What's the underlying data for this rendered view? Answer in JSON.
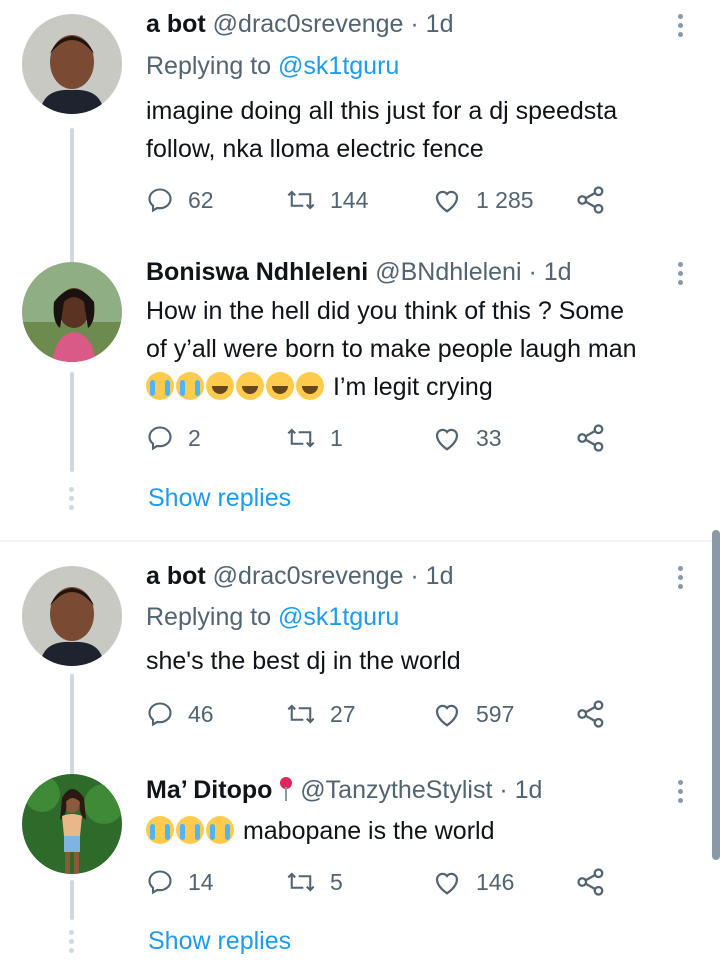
{
  "tweets": [
    {
      "name": "a bot",
      "handle": "@drac0srevenge",
      "dot": "·",
      "time": "1d",
      "replying_prefix": "Replying to",
      "replying_to": "@sk1tguru",
      "text_lines": [
        "imagine doing all this just for a dj speedsta",
        "follow, nka lloma electric fence"
      ],
      "replies": "62",
      "retweets": "144",
      "likes": "1 285"
    },
    {
      "name": "Boniswa Ndhleleni",
      "handle": "@BNdhleleni",
      "dot": "·",
      "time": "1d",
      "text_lines": [
        "How in the hell did you think of this ? Some",
        "of y’all were born to make people laugh man"
      ],
      "text_after_emoji": "I’m legit crying",
      "replies": "2",
      "retweets": "1",
      "likes": "33"
    },
    {
      "name": "a bot",
      "handle": "@drac0srevenge",
      "dot": "·",
      "time": "1d",
      "replying_prefix": "Replying to",
      "replying_to": "@sk1tguru",
      "text_lines": [
        "she's the best dj in the world"
      ],
      "replies": "46",
      "retweets": "27",
      "likes": "597"
    },
    {
      "name": "Ma’ Ditopo",
      "handle": "@TanzytheStylist",
      "dot": "·",
      "time": "1d",
      "text_after_emoji": "mabopane is the world",
      "replies": "14",
      "retweets": "5",
      "likes": "146"
    }
  ],
  "show_replies": "Show replies",
  "icons": [
    "reply-icon",
    "retweet-icon",
    "like-icon",
    "share-icon",
    "more-icon",
    "pin-icon",
    "loudly-crying-face-emoji",
    "tears-of-joy-emoji"
  ],
  "colors": {
    "link": "#1d9bf0",
    "secondary": "#536471",
    "thread_line": "#cfd9de"
  }
}
